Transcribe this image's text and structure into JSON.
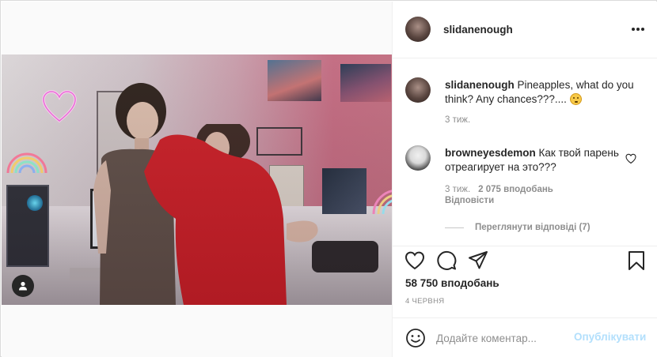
{
  "post": {
    "username": "slidanenough",
    "caption": "Pineapples, what do you think? Any chances???....",
    "caption_time": "3 тиж.",
    "likes": "58 750 вподобань",
    "date": "4 ЧЕРВНЯ"
  },
  "comment": {
    "username": "browneyesdemon",
    "text": "Как твой парень отреагирует на это???",
    "time": "3 тиж.",
    "likes": "2 075 вподобань",
    "reply_label": "Відповісти",
    "view_replies_label": "Переглянути відповіді (7)"
  },
  "comment_bar": {
    "placeholder": "Додайте коментар...",
    "publish_label": "Опублікувати"
  },
  "icons": {
    "more": "more-options-icon",
    "like": "heart-icon",
    "comment": "comment-icon",
    "share": "paper-plane-icon",
    "save": "bookmark-icon",
    "emoji": "smiley-icon",
    "tag": "person-tag-icon"
  },
  "colors": {
    "publish_disabled": "#b2dffc",
    "secondary_text": "#8e8e8e",
    "primary_text": "#262626"
  }
}
